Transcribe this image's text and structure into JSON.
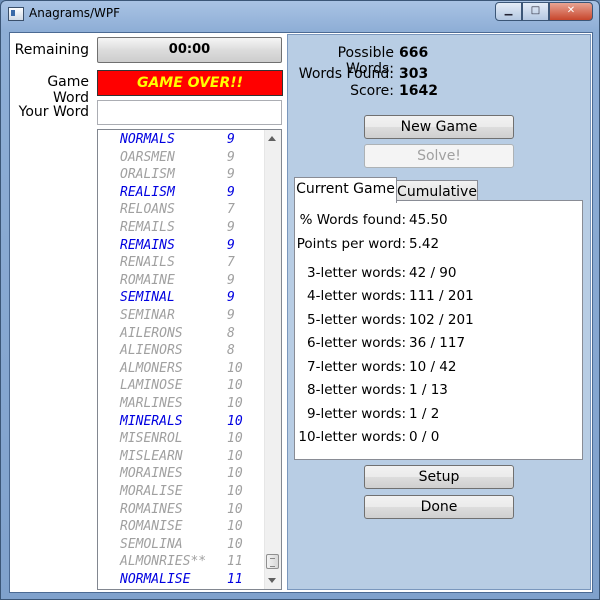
{
  "window": {
    "title": "Anagrams/WPF",
    "min_label": "▁",
    "max_label": "□",
    "close_label": "✕"
  },
  "left": {
    "remaining_label": "Remaining",
    "timer_value": "00:00",
    "gameword_label": "Game Word",
    "gameword_value": "GAME OVER!!",
    "yourword_label": "Your Word",
    "yourword_value": ""
  },
  "word_list": [
    {
      "word": "NORMALS",
      "points": "9",
      "found": true
    },
    {
      "word": "OARSMEN",
      "points": "9",
      "found": false
    },
    {
      "word": "ORALISM",
      "points": "9",
      "found": false
    },
    {
      "word": "REALISM",
      "points": "9",
      "found": true
    },
    {
      "word": "RELOANS",
      "points": "7",
      "found": false
    },
    {
      "word": "REMAILS",
      "points": "9",
      "found": false
    },
    {
      "word": "REMAINS",
      "points": "9",
      "found": true
    },
    {
      "word": "RENAILS",
      "points": "7",
      "found": false
    },
    {
      "word": "ROMAINE",
      "points": "9",
      "found": false
    },
    {
      "word": "SEMINAL",
      "points": "9",
      "found": true
    },
    {
      "word": "SEMINAR",
      "points": "9",
      "found": false
    },
    {
      "word": "AILERONS",
      "points": "8",
      "found": false
    },
    {
      "word": "ALIENORS",
      "points": "8",
      "found": false
    },
    {
      "word": "ALMONERS",
      "points": "10",
      "found": false
    },
    {
      "word": "LAMINOSE",
      "points": "10",
      "found": false
    },
    {
      "word": "MARLINES",
      "points": "10",
      "found": false
    },
    {
      "word": "MINERALS",
      "points": "10",
      "found": true
    },
    {
      "word": "MISENROL",
      "points": "10",
      "found": false
    },
    {
      "word": "MISLEARN",
      "points": "10",
      "found": false
    },
    {
      "word": "MORAINES",
      "points": "10",
      "found": false
    },
    {
      "word": "MORALISE",
      "points": "10",
      "found": false
    },
    {
      "word": "ROMAINES",
      "points": "10",
      "found": false
    },
    {
      "word": "ROMANISE",
      "points": "10",
      "found": false
    },
    {
      "word": "SEMOLINA",
      "points": "10",
      "found": false
    },
    {
      "word": "ALMONRIES**",
      "points": "11",
      "found": false
    },
    {
      "word": "NORMALISE",
      "points": "11",
      "found": true
    }
  ],
  "summary": {
    "possible_label": "Possible Words:",
    "possible_value": "666",
    "found_label": "Words Found:",
    "found_value": "303",
    "score_label": "Score:",
    "score_value": "1642"
  },
  "buttons": {
    "new_game": "New Game",
    "solve": "Solve!",
    "setup": "Setup",
    "done": "Done"
  },
  "tabs": [
    {
      "label": "Current Game",
      "active": true
    },
    {
      "label": "Cumulative",
      "active": false
    }
  ],
  "stats": [
    {
      "label": "% Words found:",
      "value": "45.50"
    },
    {
      "label": "Points per word:",
      "value": "5.42"
    },
    {
      "label": "3-letter words:",
      "value": "42 / 90"
    },
    {
      "label": "4-letter words:",
      "value": "111 / 201"
    },
    {
      "label": "5-letter words:",
      "value": "102 / 201"
    },
    {
      "label": "6-letter words:",
      "value": "36 / 117"
    },
    {
      "label": "7-letter words:",
      "value": "10 / 42"
    },
    {
      "label": "8-letter words:",
      "value": "1 / 13"
    },
    {
      "label": "9-letter words:",
      "value": "1 / 2"
    },
    {
      "label": "10-letter words:",
      "value": "0 / 0"
    }
  ]
}
